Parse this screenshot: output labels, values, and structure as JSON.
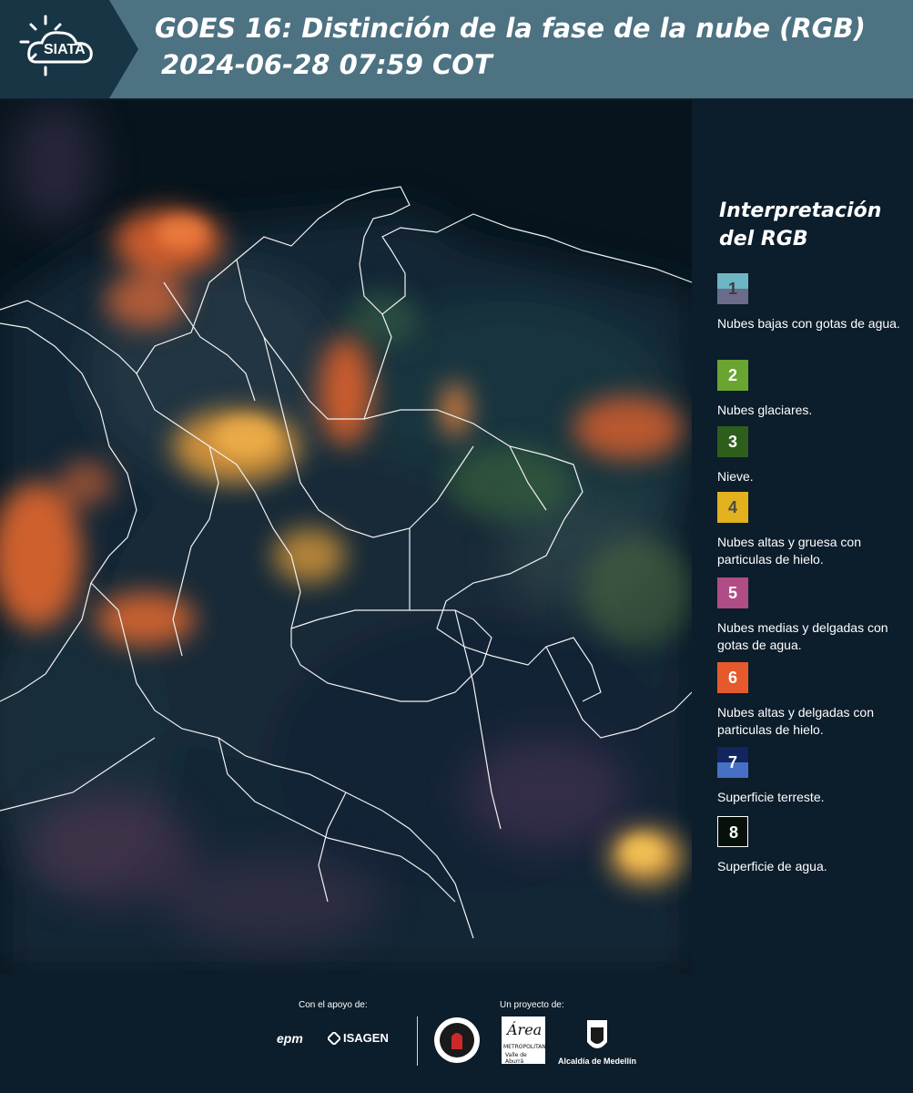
{
  "header": {
    "logo_text": "SIATA",
    "title_line1": "GOES 16: Distinción de la fase de la nube (RGB)",
    "title_line2": "2024-06-28 07:59 COT"
  },
  "legend": {
    "title": "Interpretación del RGB",
    "items": [
      {
        "number": "1",
        "label": "Nubes bajas con gotas de agua.",
        "color_top": "#6cb6c4",
        "color_bottom": "#6b6b8a",
        "num_color": "#3a3a4a"
      },
      {
        "number": "2",
        "label": "Nubes glaciares.",
        "color_top": "#6aa431",
        "color_bottom": "#6aa431",
        "num_color": "#ffffff"
      },
      {
        "number": "3",
        "label": "Nieve.",
        "color_top": "#2e5e1c",
        "color_bottom": "#2e5e1c",
        "num_color": "#ffffff"
      },
      {
        "number": "4",
        "label": "Nubes altas y gruesa con particulas de hielo.",
        "color_top": "#e3b11e",
        "color_bottom": "#e3b11e",
        "num_color": "#4a4a4a"
      },
      {
        "number": "5",
        "label": "Nubes medias y delgadas con gotas de agua.",
        "color_top": "#b04c86",
        "color_bottom": "#b04c86",
        "num_color": "#ffffff"
      },
      {
        "number": "6",
        "label": "Nubes altas y delgadas con particulas de hielo.",
        "color_top": "#e55a2c",
        "color_bottom": "#e55a2c",
        "num_color": "#ffffff"
      },
      {
        "number": "7",
        "label": "Superficie terreste.",
        "color_top": "#12255e",
        "color_bottom": "#4670c6",
        "num_color": "#ffffff"
      },
      {
        "number": "8",
        "label": "Superficie de agua.",
        "color_top": "#06110a",
        "color_bottom": "#06110a",
        "num_color": "#ffffff"
      }
    ]
  },
  "footer": {
    "support_label": "Con el apoyo de:",
    "project_label": "Un proyecto de:",
    "epm": "epm",
    "isagen": "ISAGEN",
    "area_word": "Área",
    "area_sub1": "METROPOLITANA",
    "area_sub2": "Valle de Aburrá",
    "alcaldia": "Alcaldía de Medellín"
  }
}
